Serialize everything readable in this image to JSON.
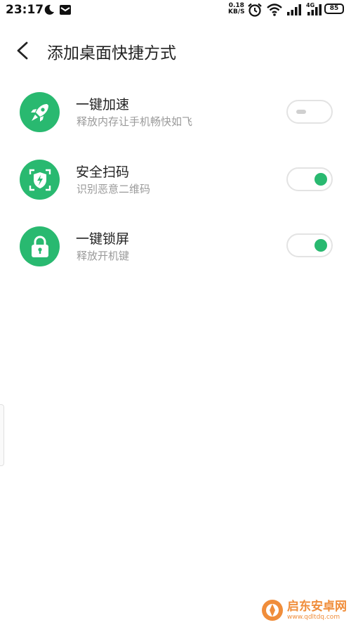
{
  "status_bar": {
    "time": "23:17",
    "net_speed_value": "0.18",
    "net_speed_unit": "KB/S",
    "network_type": "4G",
    "battery": "85"
  },
  "header": {
    "title": "添加桌面快捷方式"
  },
  "shortcuts": [
    {
      "title": "一键加速",
      "subtitle": "释放内存让手机畅快如飞",
      "icon": "rocket-icon",
      "enabled": false
    },
    {
      "title": "安全扫码",
      "subtitle": "识别恶意二维码",
      "icon": "shield-scan-icon",
      "enabled": true
    },
    {
      "title": "一键锁屏",
      "subtitle": "释放开机键",
      "icon": "lock-icon",
      "enabled": true
    }
  ],
  "colors": {
    "accent": "#29b970",
    "toggle_border": "#e3e3e3",
    "subtitle": "#9a9a9a"
  },
  "watermark": {
    "name": "启东安卓网",
    "url": "www.qdltdq.com"
  }
}
